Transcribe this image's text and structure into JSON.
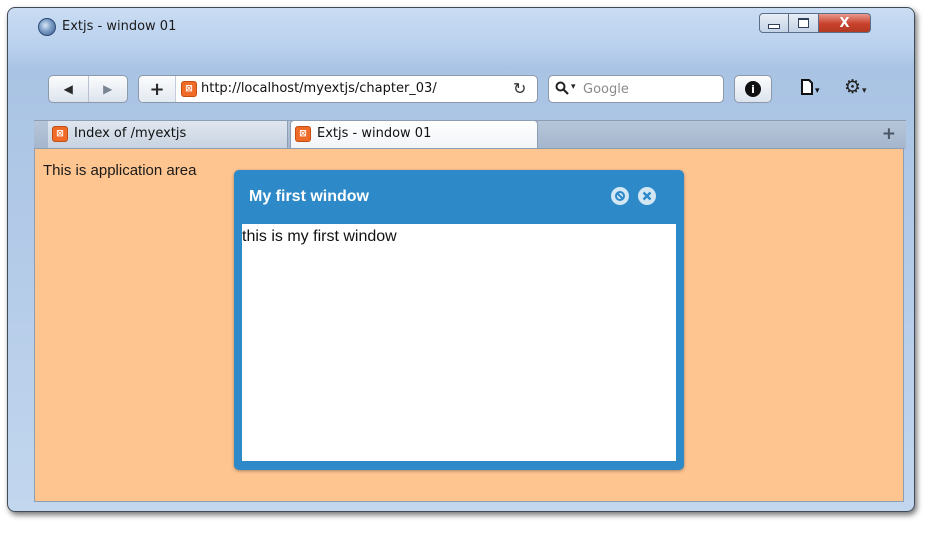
{
  "window": {
    "title": "Extjs - window 01",
    "min_icon": "minimize-icon",
    "max_icon": "maximize-icon",
    "close_label": "X"
  },
  "toolbar": {
    "back_icon": "◀",
    "forward_icon": "▶",
    "new_icon": "+",
    "url": "http://localhost/myextjs/chapter_03/",
    "reload_icon": "↻",
    "search_placeholder": "Google",
    "info_icon": "i",
    "page_icon": "page-menu-icon",
    "tools_icon": "gear-icon"
  },
  "tabs": [
    {
      "label": "Index of /myextjs",
      "active": false
    },
    {
      "label": "Extjs - window 01",
      "active": true
    }
  ],
  "new_tab_label": "+",
  "content": {
    "app_text": "This is application area",
    "background": "#ffc591"
  },
  "ext_window": {
    "title": "My first window",
    "body": "this is my first window",
    "header_color": "#2d89c8"
  }
}
